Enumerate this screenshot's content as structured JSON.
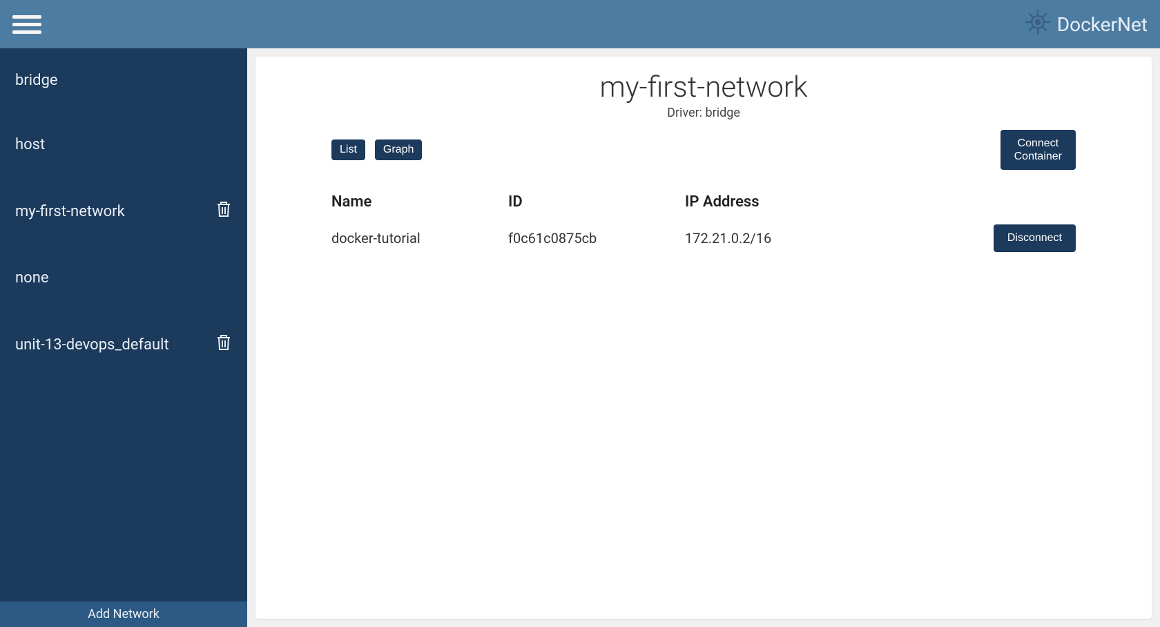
{
  "brand": {
    "name": "DockerNet"
  },
  "sidebar": {
    "items": [
      {
        "label": "bridge",
        "deletable": false
      },
      {
        "label": "host",
        "deletable": false
      },
      {
        "label": "my-first-network",
        "deletable": true
      },
      {
        "label": "none",
        "deletable": false
      },
      {
        "label": "unit-13-devops_default",
        "deletable": true
      }
    ],
    "add_label": "Add Network"
  },
  "main": {
    "title": "my-first-network",
    "subtitle": "Driver: bridge",
    "view_buttons": {
      "list": "List",
      "graph": "Graph"
    },
    "connect_label": "Connect\nContainer",
    "table": {
      "headers": {
        "name": "Name",
        "id": "ID",
        "ip": "IP Address"
      },
      "rows": [
        {
          "name": "docker-tutorial",
          "id": "f0c61c0875cb",
          "ip": "172.21.0.2/16",
          "action": "Disconnect"
        }
      ]
    }
  }
}
